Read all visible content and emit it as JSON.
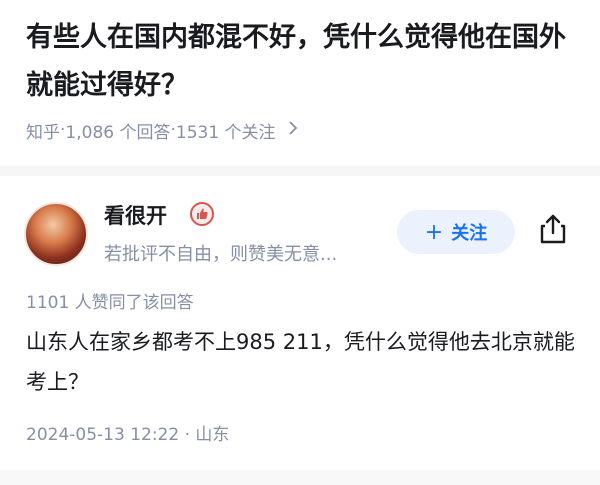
{
  "question": {
    "title": "有些人在国内都混不好，凭什么觉得他在国外就能过得好？",
    "source": "知乎",
    "answers_count": "1,086 个回答",
    "followers_count": "1531 个关注",
    "separator": " · ",
    "more_icon": "chevron-right-icon"
  },
  "answer": {
    "author": {
      "name": "看很开",
      "badge_icon": "thumbs-up-badge-icon",
      "bio": "若批评不自由，则赞美无意..."
    },
    "follow_label": "关注",
    "share_icon": "share-icon",
    "vote_text": "1101 人赞同了该回答",
    "content": "山东人在家乡都考不上985 211，凭什么觉得他去北京就能考上？",
    "date": "2024-05-13 12:22",
    "location": "山东",
    "accent_color": "#1772f6"
  }
}
